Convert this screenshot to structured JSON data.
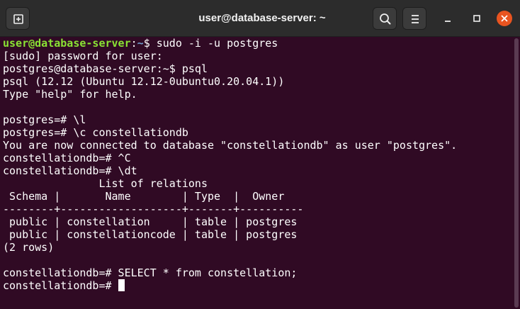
{
  "window": {
    "title": "user@database-server: ~"
  },
  "titlebar": {
    "new_tab_icon": "new-tab-icon",
    "search_icon": "search-icon",
    "menu_icon": "hamburger-menu-icon",
    "minimize_icon": "minimize-icon",
    "maximize_icon": "maximize-icon",
    "close_icon": "close-icon",
    "close_color": "#e95420"
  },
  "terminal": {
    "colors": {
      "background": "#300a24",
      "text": "#ffffff",
      "prompt_user": "#8ae234",
      "prompt_path": "#729fcf"
    },
    "first_prompt": {
      "user_host": "user@database-server",
      "path": "~",
      "command": "$ sudo -i -u postgres"
    },
    "lines": [
      "[sudo] password for user:",
      "postgres@database-server:~$ psql",
      "psql (12.12 (Ubuntu 12.12-0ubuntu0.20.04.1))",
      "Type \"help\" for help.",
      "",
      "postgres=# \\l",
      "postgres=# \\c constellationdb",
      "You are now connected to database \"constellationdb\" as user \"postgres\".",
      "constellationdb=# ^C",
      "constellationdb=# \\dt",
      "               List of relations",
      " Schema |       Name        | Type  |  Owner",
      "--------+-------------------+-------+----------",
      " public | constellation     | table | postgres",
      " public | constellationcode | table | postgres",
      "(2 rows)",
      "",
      "constellationdb=# SELECT * from constellation;"
    ],
    "current_prompt": "constellationdb=# "
  }
}
